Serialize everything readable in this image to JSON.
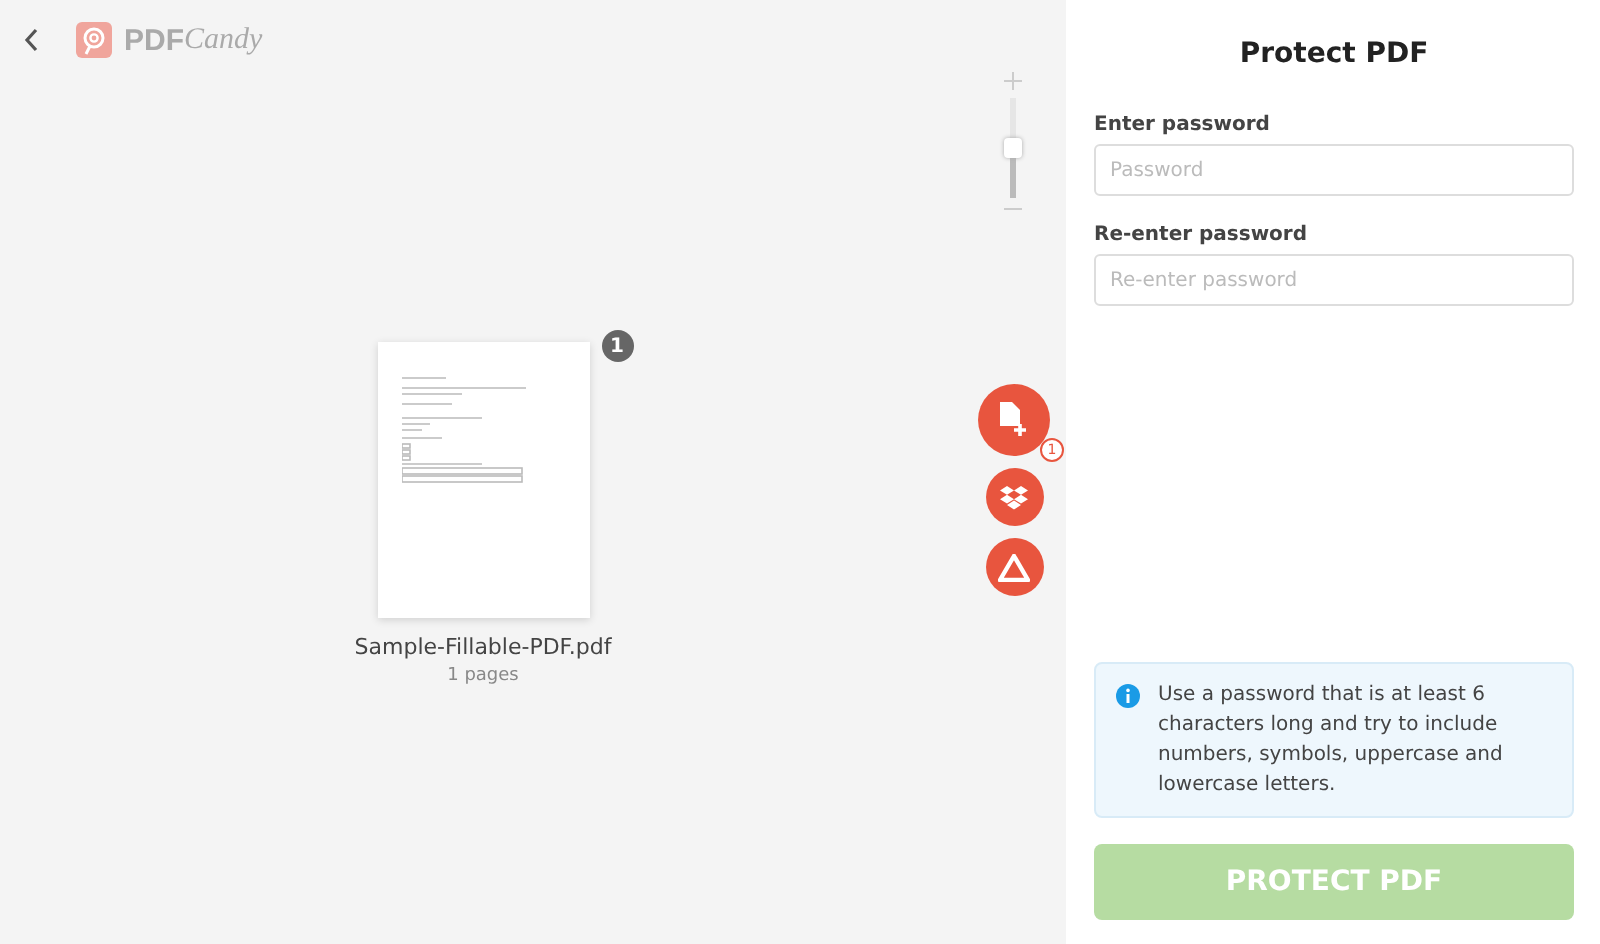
{
  "header": {
    "logo_bold": "PDF",
    "logo_italic": "Candy"
  },
  "zoom": {
    "level": 0.5
  },
  "file": {
    "count_badge": "1",
    "name": "Sample-Fillable-PDF.pdf",
    "pages": "1 pages"
  },
  "actions": {
    "add_badge": "1"
  },
  "panel": {
    "title": "Protect PDF",
    "fields": [
      {
        "label": "Enter password",
        "placeholder": "Password"
      },
      {
        "label": "Re-enter password",
        "placeholder": "Re-enter password"
      }
    ],
    "info": "Use a password that is at least 6 characters long and try to include numbers, symbols, uppercase and lowercase letters.",
    "button": {
      "label": "PROTECT PDF",
      "disabled": true
    }
  }
}
